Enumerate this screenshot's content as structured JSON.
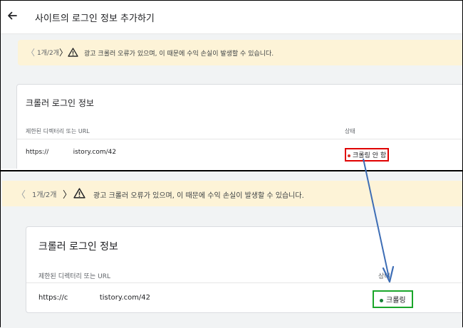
{
  "header": {
    "title": "사이트의 로그인 정보 추가하기",
    "back_icon": "arrow-left-icon"
  },
  "top": {
    "banner": {
      "prev": "〈",
      "count": "1개/2개",
      "next": "〉",
      "message": "광고 크롤러 오류가 있으며, 이 때문에 수익 손실이 발생할 수 있습니다."
    },
    "card": {
      "title": "크롤러 로그인 정보",
      "col_url": "제한된 디렉터리 또는 URL",
      "col_status": "상태",
      "url": "https://            istory.com/42",
      "status": "크롤링 안 함",
      "status_color": "#d93025",
      "highlight_color": "#e00000"
    }
  },
  "bottom": {
    "banner": {
      "prev": "〈",
      "count": "1개/2개",
      "next": "〉",
      "message": "광고 크롤러 오류가 있으며, 이 때문에 수익 손실이 발생할 수 있습니다."
    },
    "card": {
      "title": "크롤러 로그인 정보",
      "col_url": "제한된 디렉터리 또는 URL",
      "col_status": "상태",
      "url": "https://c              tistory.com/42",
      "status": "크롤링",
      "status_color": "#188038",
      "highlight_color": "#1aa62a"
    }
  },
  "annotation": {
    "arrow_color": "#3d6db5"
  }
}
